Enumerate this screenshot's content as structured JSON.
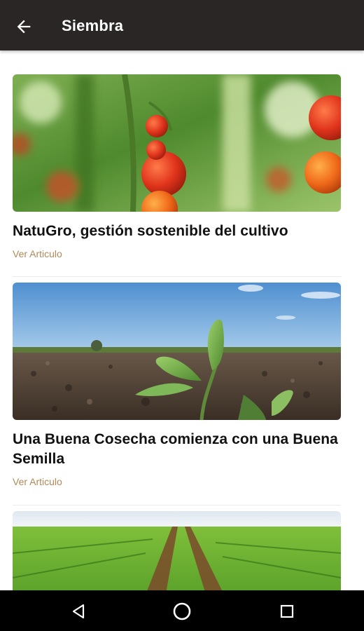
{
  "app_bar": {
    "title": "Siembra",
    "back_icon": "arrow-left-icon"
  },
  "articles": [
    {
      "title": "NatuGro, gestión sostenible del cultivo",
      "link_label": "Ver Articulo",
      "image": "tomatoes-photo"
    },
    {
      "title": "Una Buena Cosecha comienza con una Buena Semilla",
      "link_label": "Ver Articulo",
      "image": "seedling-photo"
    },
    {
      "image": "crop-field-photo"
    }
  ],
  "nav_bar": {
    "back_icon": "triangle-back-icon",
    "home_icon": "circle-home-icon",
    "recents_icon": "square-recents-icon"
  },
  "colors": {
    "app_bar_bg": "#2b2626",
    "link": "#b0895a",
    "nav_bar_bg": "#000000"
  }
}
